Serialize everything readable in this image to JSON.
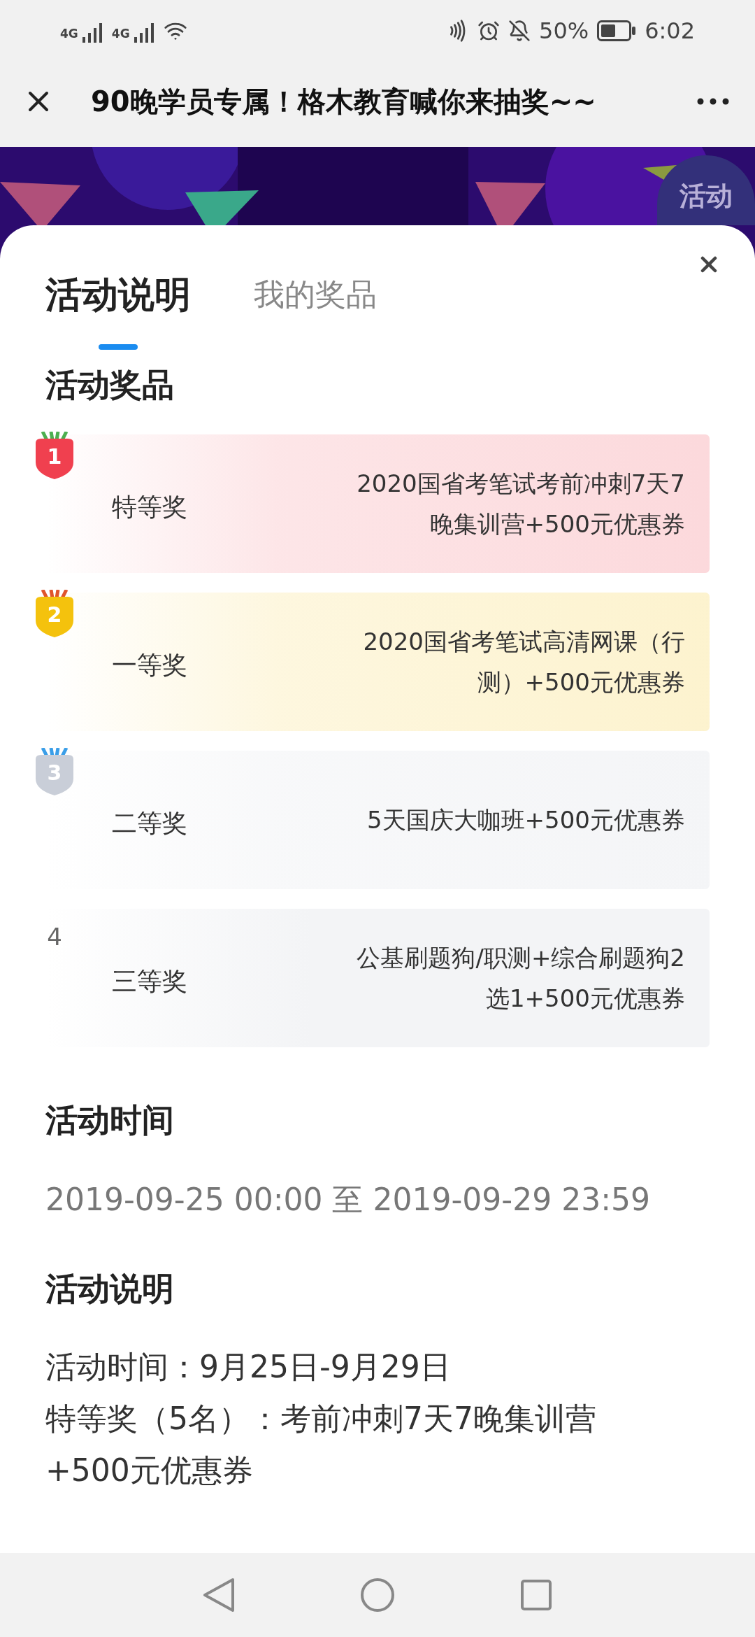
{
  "status_bar": {
    "network_1": "4G",
    "network_2": "4G",
    "battery": "50%",
    "time": "6:02"
  },
  "header": {
    "title": "90晚学员专属！格木教育喊你来抽奖~~"
  },
  "banner": {
    "button": "活动"
  },
  "tabs": [
    {
      "label": "活动说明",
      "selected": true
    },
    {
      "label": "我的奖品",
      "selected": false
    }
  ],
  "prizes_section": {
    "title": "活动奖品",
    "prizes": [
      {
        "kind": "medal",
        "rank": "1",
        "color": "#f0404f",
        "name": "特等奖",
        "description": "2020国省考笔试考前冲刺7天7晚集训营+500元优惠券"
      },
      {
        "kind": "medal",
        "rank": "2",
        "color": "#f4c20d",
        "name": "一等奖",
        "description": "2020国省考笔试高清网课（行测）+500元优惠券"
      },
      {
        "kind": "medal",
        "rank": "3",
        "color": "#c9ced8",
        "name": "二等奖",
        "description": "5天国庆大咖班+500元优惠券"
      },
      {
        "kind": "plain",
        "rank": "4",
        "color": "#666666",
        "name": "三等奖",
        "description": "公基刷题狗/职测+综合刷题狗2选1+500元优惠券"
      }
    ]
  },
  "time_section": {
    "title": "活动时间",
    "value": "2019-09-25 00:00 至 2019-09-29 23:59"
  },
  "rules_section": {
    "title": "活动说明",
    "lines": [
      "活动时间：9月25日-9月29日",
      "特等奖（5名）：考前冲刺7天7晚集训营+500元优惠券"
    ]
  }
}
